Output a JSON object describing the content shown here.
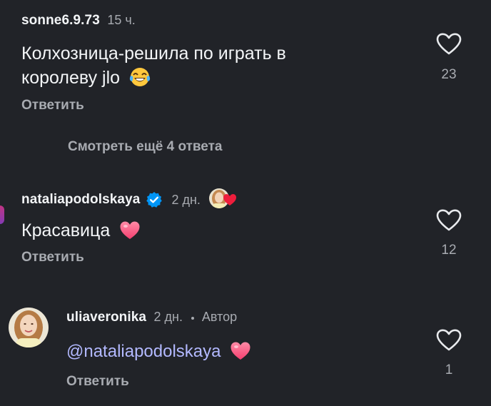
{
  "comments": [
    {
      "username": "sonne6.9.73",
      "time": "15 ч.",
      "text_line1": "Колхозница-решила по играть в",
      "text_line2": "королеву jlo",
      "emoji": "laughing-tears",
      "reply_label": "Ответить",
      "likes": "23",
      "view_more": "Смотреть ещё 4 ответа"
    },
    {
      "username": "nataliapodolskaya",
      "verified": true,
      "time": "2 дн.",
      "text": "Красавица",
      "emoji": "pink-heart",
      "reply_label": "Ответить",
      "likes": "12"
    },
    {
      "username": "uliaveronika",
      "time": "2 дн.",
      "author_label": "Автор",
      "mention": "@nataliapodolskaya",
      "emoji": "pink-heart",
      "reply_label": "Ответить",
      "likes": "1"
    }
  ],
  "colors": {
    "background": "#212328",
    "text": "#f3f5f7",
    "secondary": "#a8abb1",
    "mention": "#b3b9ff",
    "verified": "#0095f6",
    "heart": "#ff3b6b"
  }
}
